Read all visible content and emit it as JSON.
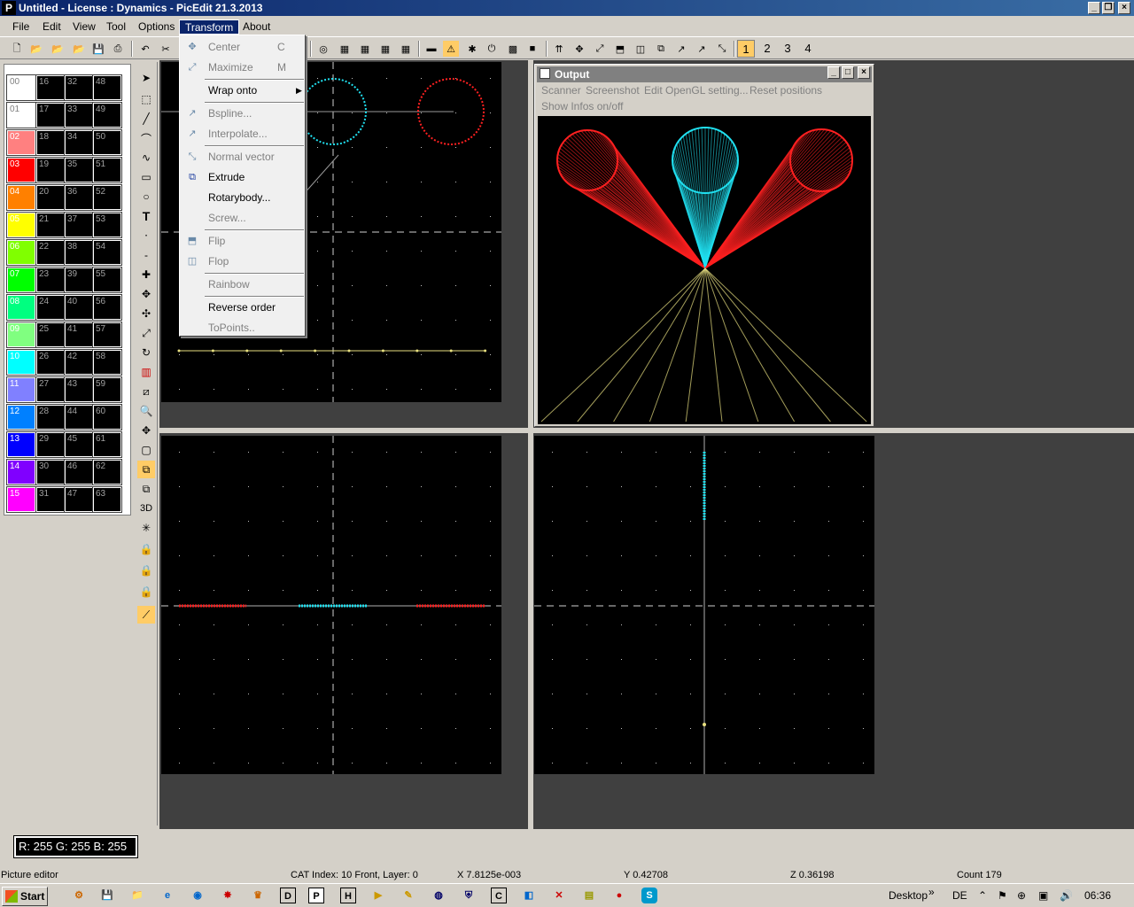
{
  "window": {
    "title": "Untitled  -  License : Dynamics  -  PicEdit 21.3.2013",
    "app_icon_letter": "P"
  },
  "menubar": [
    "File",
    "Edit",
    "View",
    "Tool",
    "Options",
    "Transform",
    "About"
  ],
  "toolbar": {
    "view_numbers": [
      "1",
      "2",
      "3",
      "4"
    ]
  },
  "palette": {
    "swatches": [
      {
        "label": "00",
        "color": "#ffffff"
      },
      {
        "label": "01",
        "color": "#ffffff"
      },
      {
        "label": "02",
        "color": "#ff8080"
      },
      {
        "label": "03",
        "color": "#ff0000"
      },
      {
        "label": "04",
        "color": "#ff8000"
      },
      {
        "label": "05",
        "color": "#ffff00"
      },
      {
        "label": "06",
        "color": "#80ff00"
      },
      {
        "label": "07",
        "color": "#00ff00"
      },
      {
        "label": "08",
        "color": "#00ff80"
      },
      {
        "label": "09",
        "color": "#80ff80"
      },
      {
        "label": "10",
        "color": "#00ffff"
      },
      {
        "label": "11",
        "color": "#8080ff"
      },
      {
        "label": "12",
        "color": "#0080ff"
      },
      {
        "label": "13",
        "color": "#0000ff"
      },
      {
        "label": "14",
        "color": "#8000ff"
      },
      {
        "label": "15",
        "color": "#ff00ff"
      }
    ],
    "black_labels": [
      [
        "16",
        "17",
        "18",
        "19",
        "20",
        "21",
        "22",
        "23",
        "24",
        "25",
        "26",
        "27",
        "28",
        "29",
        "30",
        "31"
      ],
      [
        "32",
        "33",
        "34",
        "35",
        "36",
        "37",
        "38",
        "39",
        "40",
        "41",
        "42",
        "43",
        "44",
        "45",
        "46",
        "47"
      ],
      [
        "48",
        "49",
        "50",
        "51",
        "52",
        "53",
        "54",
        "55",
        "56",
        "57",
        "58",
        "59",
        "60",
        "61",
        "62",
        "63"
      ]
    ]
  },
  "toolbox": {
    "threed_label": "3D"
  },
  "transform_menu": [
    {
      "label": "Center",
      "shortcut": "C",
      "enabled": false,
      "icon": "center-icon"
    },
    {
      "label": "Maximize",
      "shortcut": "M",
      "enabled": false,
      "icon": "maximize-icon"
    },
    {
      "sep": true
    },
    {
      "label": "Wrap onto",
      "enabled": true,
      "submenu": true
    },
    {
      "sep": true
    },
    {
      "label": "Bspline...",
      "enabled": false,
      "icon": "bspline-icon"
    },
    {
      "label": "Interpolate...",
      "enabled": false,
      "icon": "interpolate-icon"
    },
    {
      "sep": true
    },
    {
      "label": "Normal vector",
      "enabled": false,
      "icon": "normal-vector-icon"
    },
    {
      "label": "Extrude",
      "enabled": true,
      "icon": "extrude-icon"
    },
    {
      "label": "Rotarybody...",
      "enabled": true
    },
    {
      "label": "Screw...",
      "enabled": false
    },
    {
      "sep": true
    },
    {
      "label": "Flip",
      "enabled": false,
      "icon": "flip-icon"
    },
    {
      "label": "Flop",
      "enabled": false,
      "icon": "flop-icon"
    },
    {
      "sep": true
    },
    {
      "label": "Rainbow",
      "enabled": false
    },
    {
      "sep": true
    },
    {
      "label": "Reverse order",
      "enabled": true
    },
    {
      "label": "ToPoints..",
      "enabled": false
    }
  ],
  "output_window": {
    "title": "Output",
    "menu": [
      "Scanner",
      "Screenshot",
      "Edit OpenGL setting...",
      "Reset positions",
      "Show Infos on/off"
    ]
  },
  "colors": {
    "red": "#ff2020",
    "cyan": "#20e0f0",
    "yellow": "#e8e080"
  },
  "rgb_readout": "R: 255 G: 255 B: 255",
  "statusbar": {
    "mode": "Picture editor",
    "cat_index": "CAT Index: 10 Front, Layer: 0",
    "x": "X 7.8125e-003",
    "y": "Y 0.42708",
    "z": "Z 0.36198",
    "count": "Count 179"
  },
  "taskbar": {
    "start": "Start",
    "desktop": "Desktop",
    "lang": "DE",
    "clock": "06:36"
  }
}
